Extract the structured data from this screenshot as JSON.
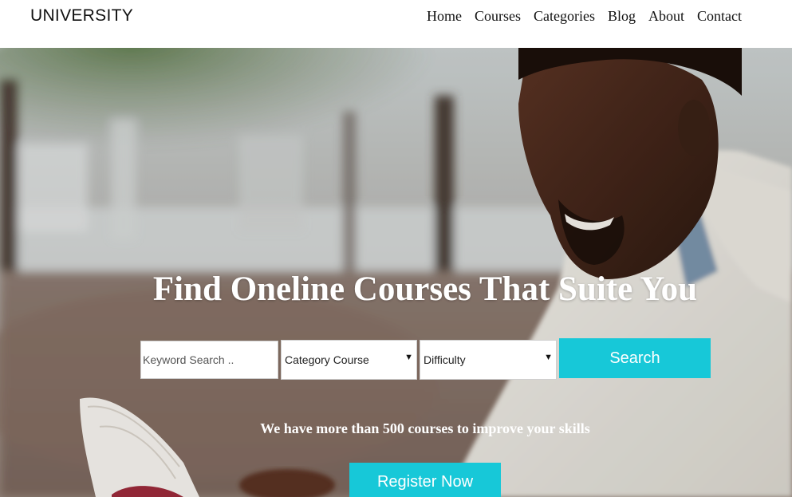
{
  "brand": {
    "name": "UNIVERSITY"
  },
  "nav": {
    "items": [
      {
        "label": "Home"
      },
      {
        "label": "Courses"
      },
      {
        "label": "Categories"
      },
      {
        "label": "Blog"
      },
      {
        "label": "About"
      },
      {
        "label": "Contact"
      }
    ]
  },
  "hero": {
    "title": "Find Oneline Courses That Suite You",
    "subtitle": "We have more than 500 courses to improve your skills",
    "image_icon": "photo-man-reading-book"
  },
  "search": {
    "keyword_placeholder": "Keyword Search ..",
    "keyword_value": "",
    "category_selected": "Category Course",
    "difficulty_selected": "Difficulty",
    "button_label": "Search"
  },
  "cta": {
    "register_label": "Register Now"
  },
  "colors": {
    "accent": "#17c8d8",
    "nav_background": "#ffffff",
    "hero_text": "#ffffff"
  }
}
